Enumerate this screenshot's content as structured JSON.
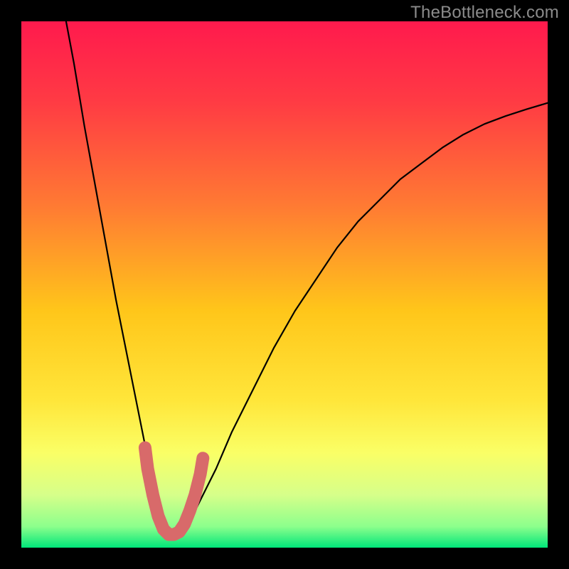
{
  "watermark": "TheBottleneck.com",
  "chart_data": {
    "type": "line",
    "title": "",
    "xlabel": "",
    "ylabel": "",
    "xlim": [
      0,
      100
    ],
    "ylim": [
      0,
      100
    ],
    "grid": false,
    "legend": false,
    "gradient_stops": [
      {
        "offset": 0.0,
        "color": "#ff1a4d"
      },
      {
        "offset": 0.15,
        "color": "#ff3a44"
      },
      {
        "offset": 0.35,
        "color": "#ff7a33"
      },
      {
        "offset": 0.55,
        "color": "#ffc61a"
      },
      {
        "offset": 0.72,
        "color": "#ffe63a"
      },
      {
        "offset": 0.82,
        "color": "#faff66"
      },
      {
        "offset": 0.9,
        "color": "#d6ff8a"
      },
      {
        "offset": 0.96,
        "color": "#8cff8c"
      },
      {
        "offset": 1.0,
        "color": "#00e67a"
      }
    ],
    "series": [
      {
        "name": "bottleneck-curve",
        "stroke": "#000000",
        "x": [
          8.5,
          10,
          12,
          14,
          16,
          18,
          20,
          22,
          24,
          25,
          26,
          27,
          28,
          29,
          30,
          31,
          32,
          34,
          37,
          40,
          44,
          48,
          52,
          56,
          60,
          64,
          68,
          72,
          76,
          80,
          84,
          88,
          92,
          96,
          100
        ],
        "y": [
          100,
          92,
          80,
          69,
          58,
          47,
          37,
          27,
          17,
          12,
          8,
          5,
          3,
          2,
          2,
          3,
          5,
          9,
          15,
          22,
          30,
          38,
          45,
          51,
          57,
          62,
          66,
          70,
          73,
          76,
          78.5,
          80.5,
          82,
          83.3,
          84.5
        ]
      },
      {
        "name": "min-marker",
        "stroke": "#d86a6a",
        "thick": true,
        "x": [
          23.5,
          24,
          25,
          26,
          27,
          28,
          29,
          30,
          31,
          32,
          33,
          34,
          34.5
        ],
        "y": [
          19,
          15,
          10,
          6,
          3.5,
          2.5,
          2.5,
          3,
          4.5,
          7,
          10,
          14,
          17
        ]
      }
    ],
    "annotations": []
  }
}
